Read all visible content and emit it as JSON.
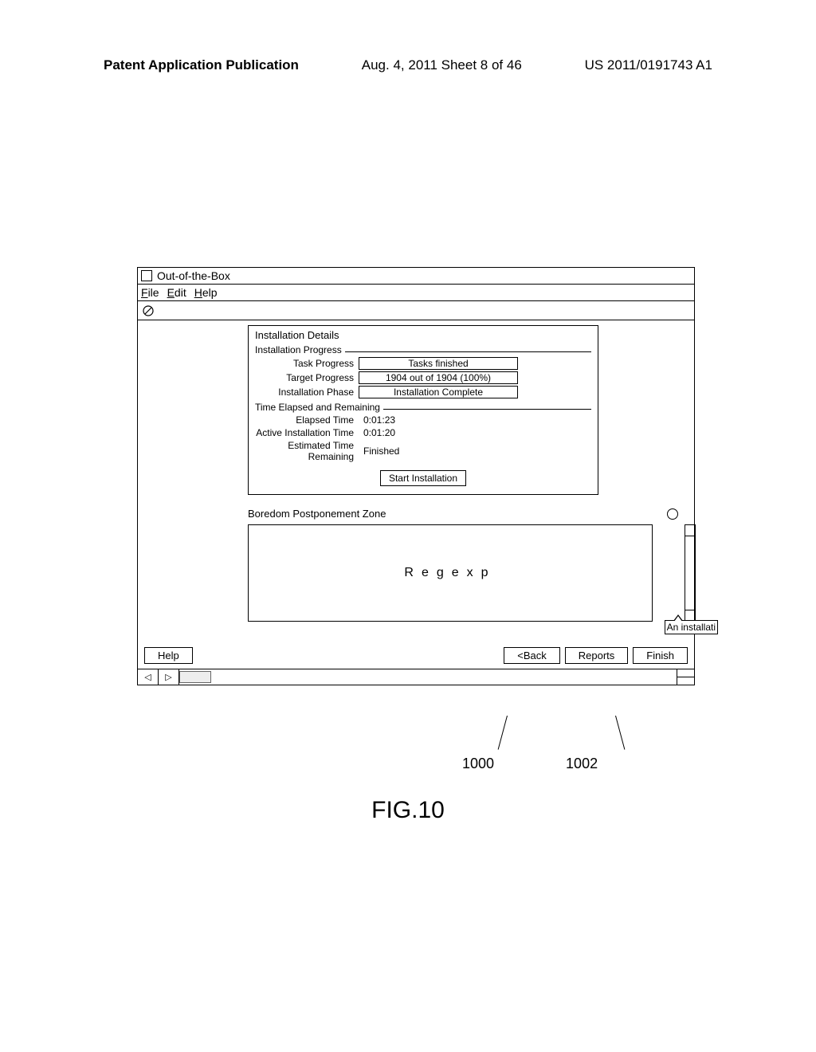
{
  "page_header": {
    "left": "Patent Application Publication",
    "center": "Aug. 4, 2011  Sheet 8 of 46",
    "right": "US 2011/0191743 A1"
  },
  "window": {
    "title": "Out-of-the-Box",
    "menu": {
      "file": "File",
      "edit": "Edit",
      "help": "Help"
    }
  },
  "panel": {
    "title": "Installation Details",
    "progress_legend": "Installation Progress",
    "task_progress_label": "Task Progress",
    "task_progress_value": "Tasks finished",
    "target_progress_label": "Target Progress",
    "target_progress_value": "1904 out of 1904 (100%)",
    "phase_label": "Installation Phase",
    "phase_value": "Installation Complete",
    "time_legend": "Time Elapsed and Remaining",
    "elapsed_label": "Elapsed Time",
    "elapsed_value": "0:01:23",
    "active_label": "Active Installation Time",
    "active_value": "0:01:20",
    "remaining_label": "Estimated Time Remaining",
    "remaining_value": "Finished",
    "start_button": "Start Installation"
  },
  "boredom": {
    "header": "Boredom Postponement Zone",
    "content": "Regexp"
  },
  "tooltip": "An installati",
  "buttons": {
    "help": "Help",
    "back": "<Back",
    "reports": "Reports",
    "finish": "Finish"
  },
  "status": {
    "prev": "◁",
    "next": "▷"
  },
  "callouts": {
    "c1": "1000",
    "c2": "1002"
  },
  "figure": "FIG.10"
}
